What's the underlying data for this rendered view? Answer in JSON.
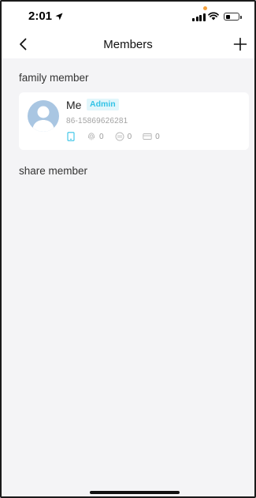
{
  "status_bar": {
    "time": "2:01",
    "battery_level": 0.3,
    "orange_dot_color": "#f5a03a"
  },
  "nav": {
    "title": "Members",
    "back_icon": "chevron-left-icon",
    "add_icon": "plus-icon"
  },
  "family_section": {
    "label": "family member",
    "members": [
      {
        "name": "Me",
        "role": "Admin",
        "phone": "86-15869626281",
        "credentials": [
          {
            "icon": "phone-key-icon",
            "count": ""
          },
          {
            "icon": "fingerprint-icon",
            "count": "0"
          },
          {
            "icon": "password-icon",
            "count": "0"
          },
          {
            "icon": "card-icon",
            "count": "0"
          }
        ]
      }
    ]
  },
  "share_section": {
    "label": "share member"
  },
  "colors": {
    "accent": "#34c3e6",
    "badge_bg": "#e2f6fb",
    "page_bg": "#f4f4f6"
  }
}
